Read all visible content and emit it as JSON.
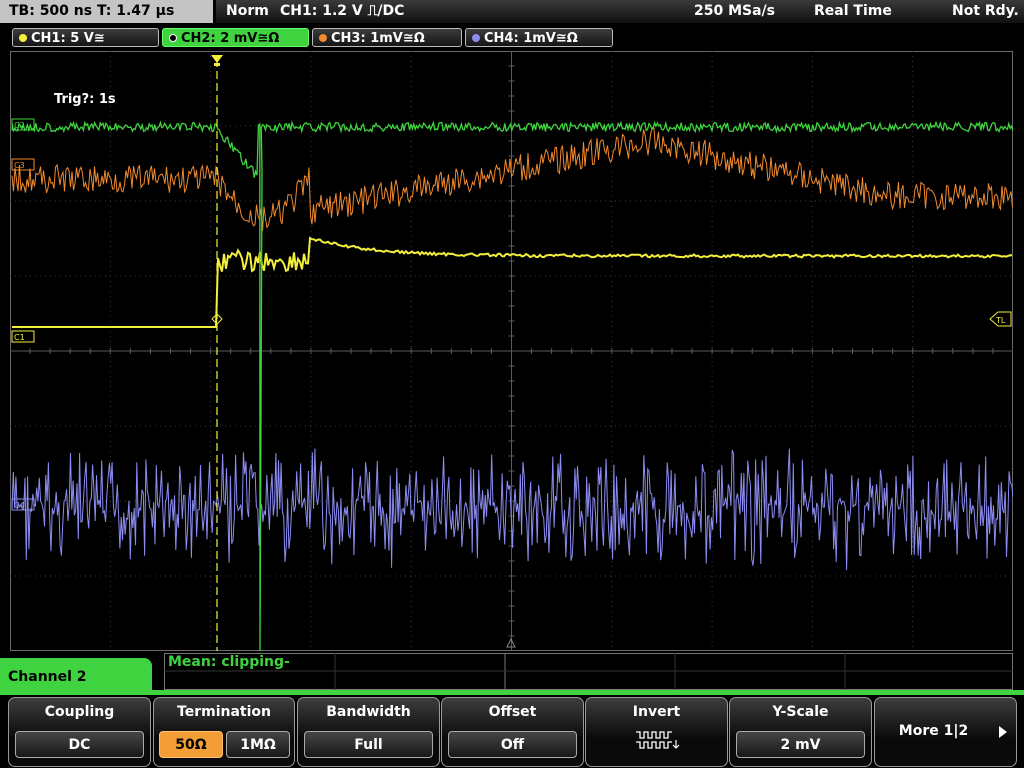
{
  "status": {
    "timebase": "TB: 500 ns   T: 1.47 μs",
    "mode": "Norm",
    "trigger": "CH1: 1.2 V ⎍/DC",
    "sample_rate": "250 MSa/s",
    "acq_mode": "Real Time",
    "state": "Not Rdy."
  },
  "channel_tabs": [
    {
      "label": "CH1: 5 V≅",
      "color": "#f2ee3c"
    },
    {
      "label": "CH2: 2 mV≅Ω",
      "color": "#3fd43f"
    },
    {
      "label": "CH3: 1mV≅Ω",
      "color": "#f28a2e"
    },
    {
      "label": "CH4: 1mV≅Ω",
      "color": "#8c8cf2"
    }
  ],
  "screen": {
    "trig_info": "Trig?: 1s",
    "markers": {
      "ch1": "C1",
      "ch2": "C2",
      "ch3": "C3",
      "ch4": "C4",
      "trig_level": "TL"
    }
  },
  "bottom": {
    "channel_label": "Channel 2",
    "mean_text": "Mean: clipping-"
  },
  "softkeys": {
    "coupling": {
      "title": "Coupling",
      "value": "DC"
    },
    "termination": {
      "title": "Termination",
      "opt1": "50Ω",
      "opt2": "1MΩ"
    },
    "bandwidth": {
      "title": "Bandwidth",
      "value": "Full"
    },
    "offset": {
      "title": "Offset",
      "value": "Off"
    },
    "invert": {
      "title": "Invert",
      "value": "⊓⊓⊓⊓"
    },
    "yscale": {
      "title": "Y-Scale",
      "value": "2 mV"
    },
    "more": {
      "label": "More 1|2"
    }
  },
  "colors": {
    "ch1": "#f2ee3c",
    "ch2": "#3fd43f",
    "ch3": "#f28a2e",
    "ch4": "#8c8cf2",
    "selected": "#f29d35"
  }
}
